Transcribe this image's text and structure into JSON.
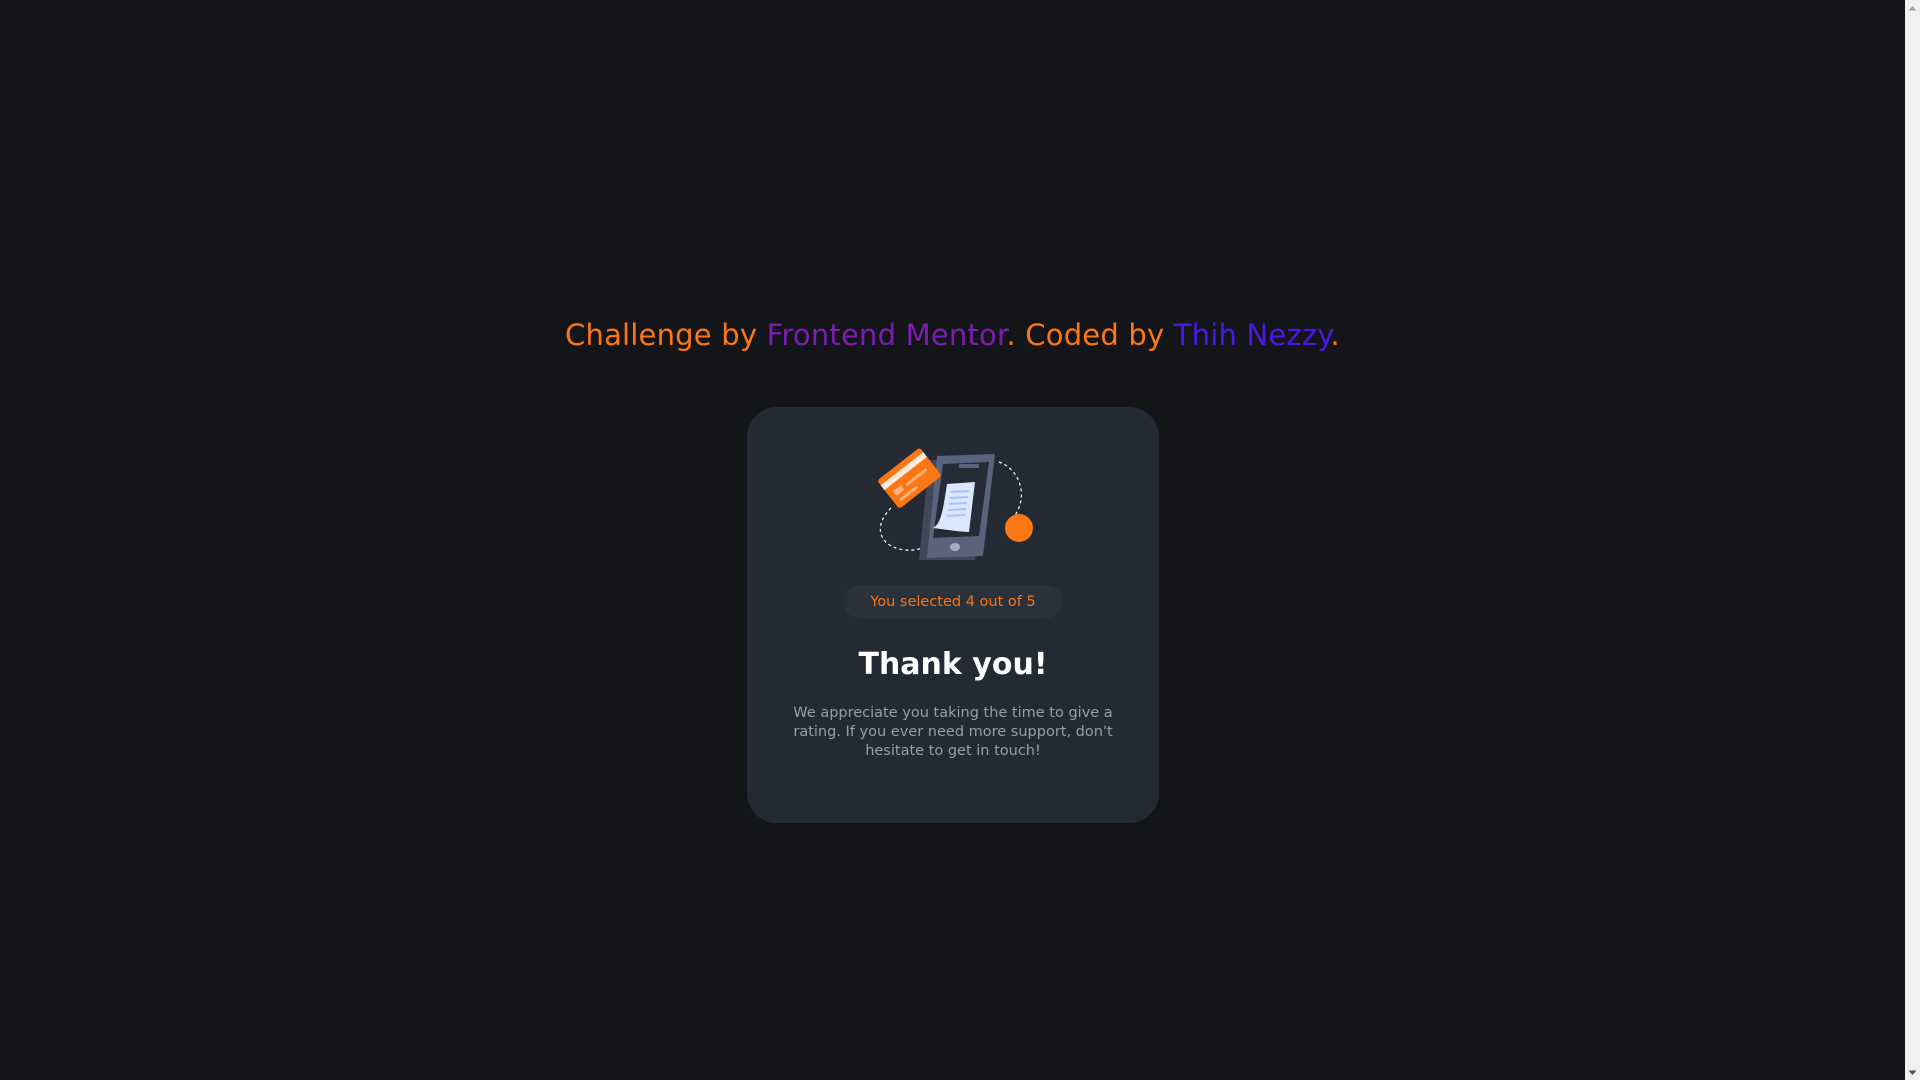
{
  "attribution": {
    "prefix": "Challenge by ",
    "challenge_link": "Frontend Mentor",
    "middle": ". Coded by ",
    "author_link": "Thih Nezzy",
    "suffix": "."
  },
  "card": {
    "illustration_icon": "payment-phone-illustration",
    "badge_text": "You selected 4 out of 5",
    "title": "Thank you!",
    "message": "We appreciate you taking the time to give a rating. If you ever need more support, don't hesitate to get in touch!"
  },
  "colors": {
    "background": "#131518",
    "card": "#232a34",
    "accent": "#fc7614",
    "link_frontend_mentor": "#7a1db0",
    "link_author": "#4b17e8",
    "text_muted": "#959eac"
  }
}
